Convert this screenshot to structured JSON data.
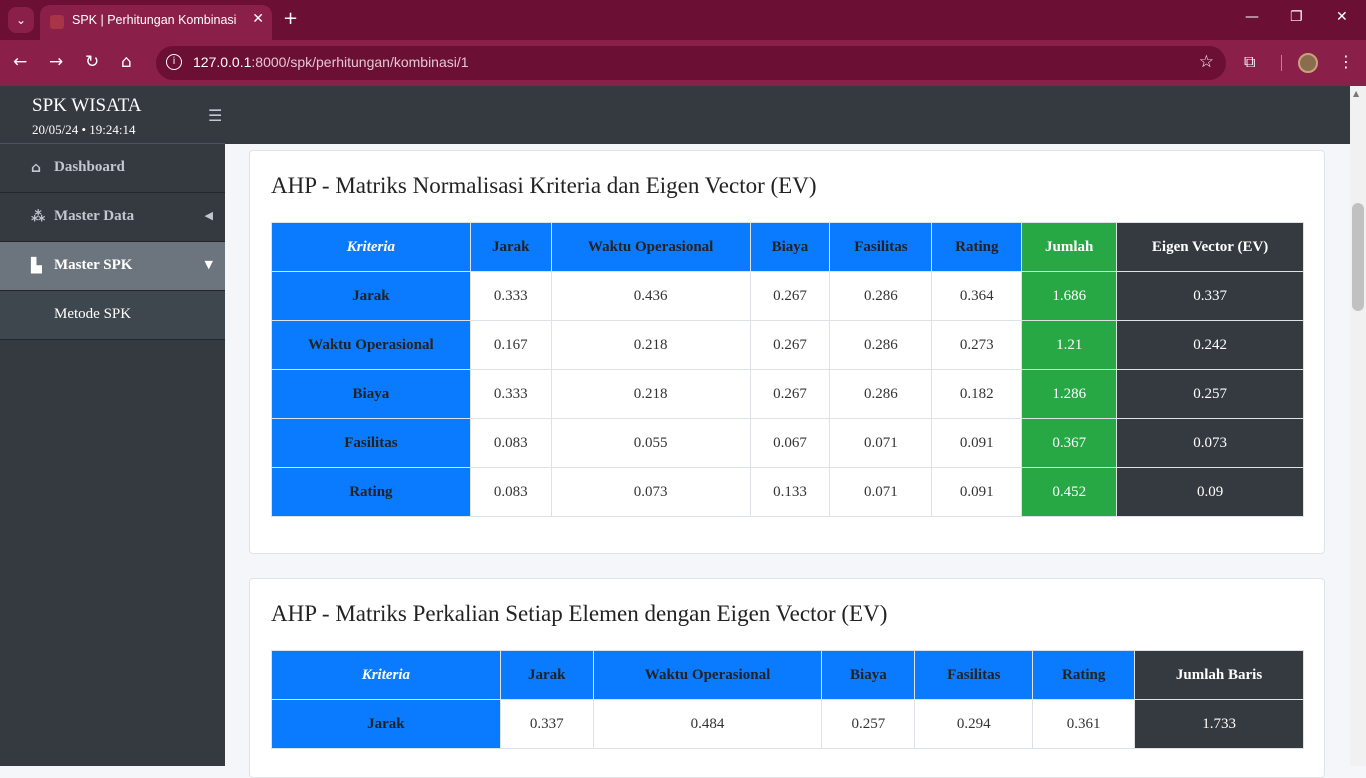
{
  "browser": {
    "tab_title": "SPK | Perhitungan Kombinasi",
    "url_host": "127.0.0.1",
    "url_path": ":8000/spk/perhitungan/kombinasi/1"
  },
  "sidebar": {
    "brand": "SPK WISATA",
    "datetime": "20/05/24 • 19:24:14",
    "items": [
      {
        "label": "Dashboard",
        "icon": "home-icon"
      },
      {
        "label": "Master Data",
        "icon": "cubes-icon"
      },
      {
        "label": "Master SPK",
        "icon": "chart-icon"
      },
      {
        "label": "Metode SPK"
      }
    ]
  },
  "table1": {
    "title": "AHP - Matriks Normalisasi Kriteria dan Eigen Vector (EV)",
    "headers": [
      "Kriteria",
      "Jarak",
      "Waktu Operasional",
      "Biaya",
      "Fasilitas",
      "Rating",
      "Jumlah",
      "Eigen Vector (EV)"
    ],
    "rows": [
      [
        "Jarak",
        "0.333",
        "0.436",
        "0.267",
        "0.286",
        "0.364",
        "1.686",
        "0.337"
      ],
      [
        "Waktu Operasional",
        "0.167",
        "0.218",
        "0.267",
        "0.286",
        "0.273",
        "1.21",
        "0.242"
      ],
      [
        "Biaya",
        "0.333",
        "0.218",
        "0.267",
        "0.286",
        "0.182",
        "1.286",
        "0.257"
      ],
      [
        "Fasilitas",
        "0.083",
        "0.055",
        "0.067",
        "0.071",
        "0.091",
        "0.367",
        "0.073"
      ],
      [
        "Rating",
        "0.083",
        "0.073",
        "0.133",
        "0.071",
        "0.091",
        "0.452",
        "0.09"
      ]
    ]
  },
  "table2": {
    "title": "AHP - Matriks Perkalian Setiap Elemen dengan Eigen Vector (EV)",
    "headers": [
      "Kriteria",
      "Jarak",
      "Waktu Operasional",
      "Biaya",
      "Fasilitas",
      "Rating",
      "Jumlah Baris"
    ],
    "rows": [
      [
        "Jarak",
        "0.337",
        "0.484",
        "0.257",
        "0.294",
        "0.361",
        "1.733"
      ]
    ]
  },
  "colors": {
    "brand_bar": "#6b0f35",
    "blue": "#0a7bff",
    "green": "#28a745",
    "dark": "#343a40"
  }
}
